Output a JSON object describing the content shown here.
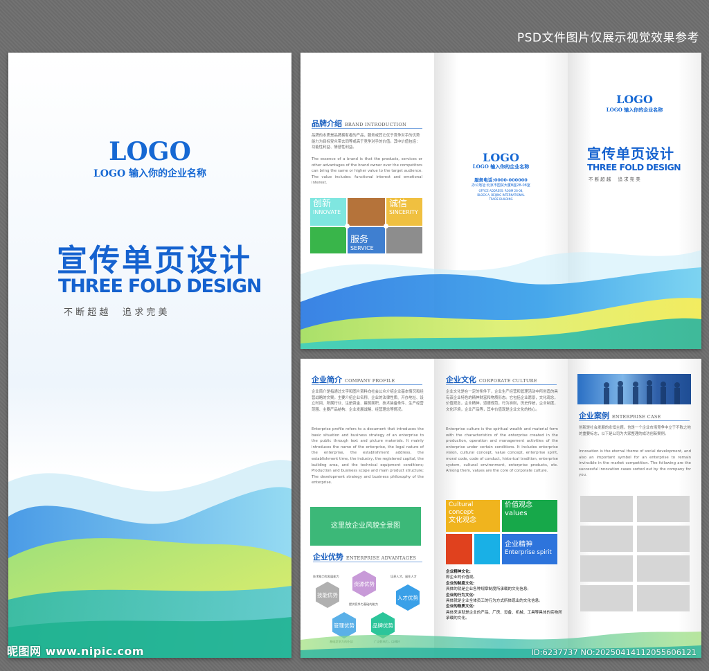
{
  "top_note": "PSD文件图片仅展示视觉效果参考",
  "front": {
    "logo": "LOGO",
    "logo_sub": "LOGO 输入你的企业名称",
    "title_cn": "宣传单页设计",
    "title_en": "THREE FOLD DESIGN",
    "slogan": "不 断 超 越     追 求 完 美"
  },
  "outer": {
    "brand_title": "品牌介绍",
    "brand_title_en": "BRAND INTRODUCTION",
    "brand_text_cn": "品牌的本质是品牌拥有者的产品，服务或其它优于竞争对手的优势能力为目标受众带去同等或高于竞争对手的价值。其中价值包括：功能性利益、情感性利益。",
    "brand_text_en": "The essence of a brand is that the products, services or other advantages of the brand owner over the competitors can bring the same or higher value to the target audience. The value includes: functional interest and emotional interest.",
    "tiles": [
      {
        "cn": "创新",
        "en": "INNOVATE",
        "color": "#7fe6e0"
      },
      {
        "cn": "",
        "en": "",
        "color": "#b5733a"
      },
      {
        "cn": "诚信",
        "en": "SINCERITY",
        "color": "#f0c040"
      },
      {
        "cn": "",
        "en": "",
        "color": "#39b54a"
      },
      {
        "cn": "服务",
        "en": "SERVICE",
        "color": "#3f7fd0"
      },
      {
        "cn": "",
        "en": "",
        "color": "#8d8d8d"
      }
    ],
    "mid_logo": "LOGO",
    "mid_logo_sub": "LOGO 输入你的企业名称",
    "mid_phone": "服务电话:0000-000000",
    "mid_address": "办公地址:北京市国贸大厦B座28-08室",
    "mid_addr_en1": "OFFICE ADDRESS: ROOM 28-08,",
    "mid_addr_en2": "BLOCK A, BEIJING INTERNATIONAL",
    "mid_addr_en3": "TRADE BUILDING",
    "right_logo": "LOGO",
    "right_logo_sub": "LOGO 输入你的企业名称",
    "right_title_cn": "宣传单页设计",
    "right_title_en": "THREE FOLD DESIGN",
    "right_slogan": "不 断 超 越     追 求 完 美"
  },
  "inner": {
    "profile_title": "企业简介",
    "profile_title_en": "COMPANY PROFILE",
    "profile_text_cn": "企业简介是指通过文字和图片资料向社会公众介绍企业基本情况和经营战略的文案。主要介绍企业名称、企业的法律性质、开办地址、设立时间、所属行业、注册资金、建筑面积、技术装备条件、生产经营范围、主要产品结构、企业发展战略、经营理念等情况。",
    "profile_text_en": "Enterprise profile refers to a document that introduces the basic situation and business strategy of an enterprise to the public through text and picture materials. It mainly introduces the name of the enterprise, the legal nature of the enterprise, the establishment address, the establishment time, the industry, the registered capital, the building area, and the technical equipment conditions; Production and business scope and main product structure; The development strategy and business philosophy of the enterprise.",
    "photo_placeholder": "这里放企业风貌全景图",
    "advantage_title": "企业优势",
    "advantage_title_en": "ENTERPRISE ADVANTAGES",
    "hex_items": [
      {
        "label": "技能优势",
        "color": "#b0b0b0"
      },
      {
        "label": "资源优势",
        "color": "#c89ad8"
      },
      {
        "label": "人才优势",
        "color": "#3aa0e8"
      },
      {
        "label": "管理优势",
        "color": "#5ab0e8"
      },
      {
        "label": "品牌优势",
        "color": "#2cc59a"
      }
    ],
    "hex_notes": [
      "技术能力和发展能力",
      "培养人才，留住人才",
      "提供竞争力基础的能力",
      "基础竞争力的外部",
      "广泛影响力，口碑好"
    ],
    "culture_title": "企业文化",
    "culture_title_en": "CORPORATE CULTURE",
    "culture_text_cn": "企业文化是在一定的条件下，企业生产经营和管理活动中所创造的具有该企业特色的精神财富和物质形态。它包括企业愿景，文化观念，价值观念，企业精神，道德规范，行为准则，历史传统，企业制度，文化环境，企业产品等，其中价值观是企业文化的核心。",
    "culture_text_en": "Enterprise culture is the spiritual wealth and material form with the characteristics of the enterprise created in the production, operation and management activities of the enterprise under certain conditions. It includes enterprise vision, cultural concept, value concept, enterprise spirit, moral code, code of conduct, historical tradition, enterprise system, cultural environment, enterprise products, etc. Among them, values are the core of corporate culture.",
    "culture_tiles": [
      {
        "cn": "文化观念",
        "en": "Cultural concept",
        "color": "#f0b41e"
      },
      {
        "cn": "价值观念",
        "en": "values",
        "color": "#17a84a"
      },
      {
        "cn": "",
        "en": "",
        "color": "#e0411e"
      },
      {
        "cn": "",
        "en": "",
        "color": "#19b0e6"
      },
      {
        "cn": "企业精神",
        "en": "Enterprise spirit",
        "color": "#2d74dc"
      }
    ],
    "culture_list": [
      {
        "head": "企业精神文化:",
        "body": "即企业的价值观。"
      },
      {
        "head": "企业的制度文化:",
        "body": "具体的就是企业各种规章制度所承载的文化信息;"
      },
      {
        "head": "企业的行为文化:",
        "body": "具体就是企业全体员工的行为方式所体现出的文化信息;"
      },
      {
        "head": "企业的物质文化:",
        "body": "具体来讲就是企业的产品、厂房、设备、机械、工具等具体的实物所承载的文化。"
      }
    ],
    "case_title": "企业案例",
    "case_title_en": "ENTERPRISE CASE",
    "case_text_cn": "创新是社会发展的永恒主题，也是一个企业市场竞争中立于不败之地的重要标志，以下是公司为大家整理的成功创新案例。",
    "case_text_en": "Innovation is the eternal theme of social development, and also an important symbol for an enterprise to remain invincible in the market competition. The following are the successful innovation cases sorted out by the company for you."
  },
  "watermark_left": "昵图网 www.nipic.com",
  "watermark_right": "ID:6237737 NO:20250414112055606121"
}
